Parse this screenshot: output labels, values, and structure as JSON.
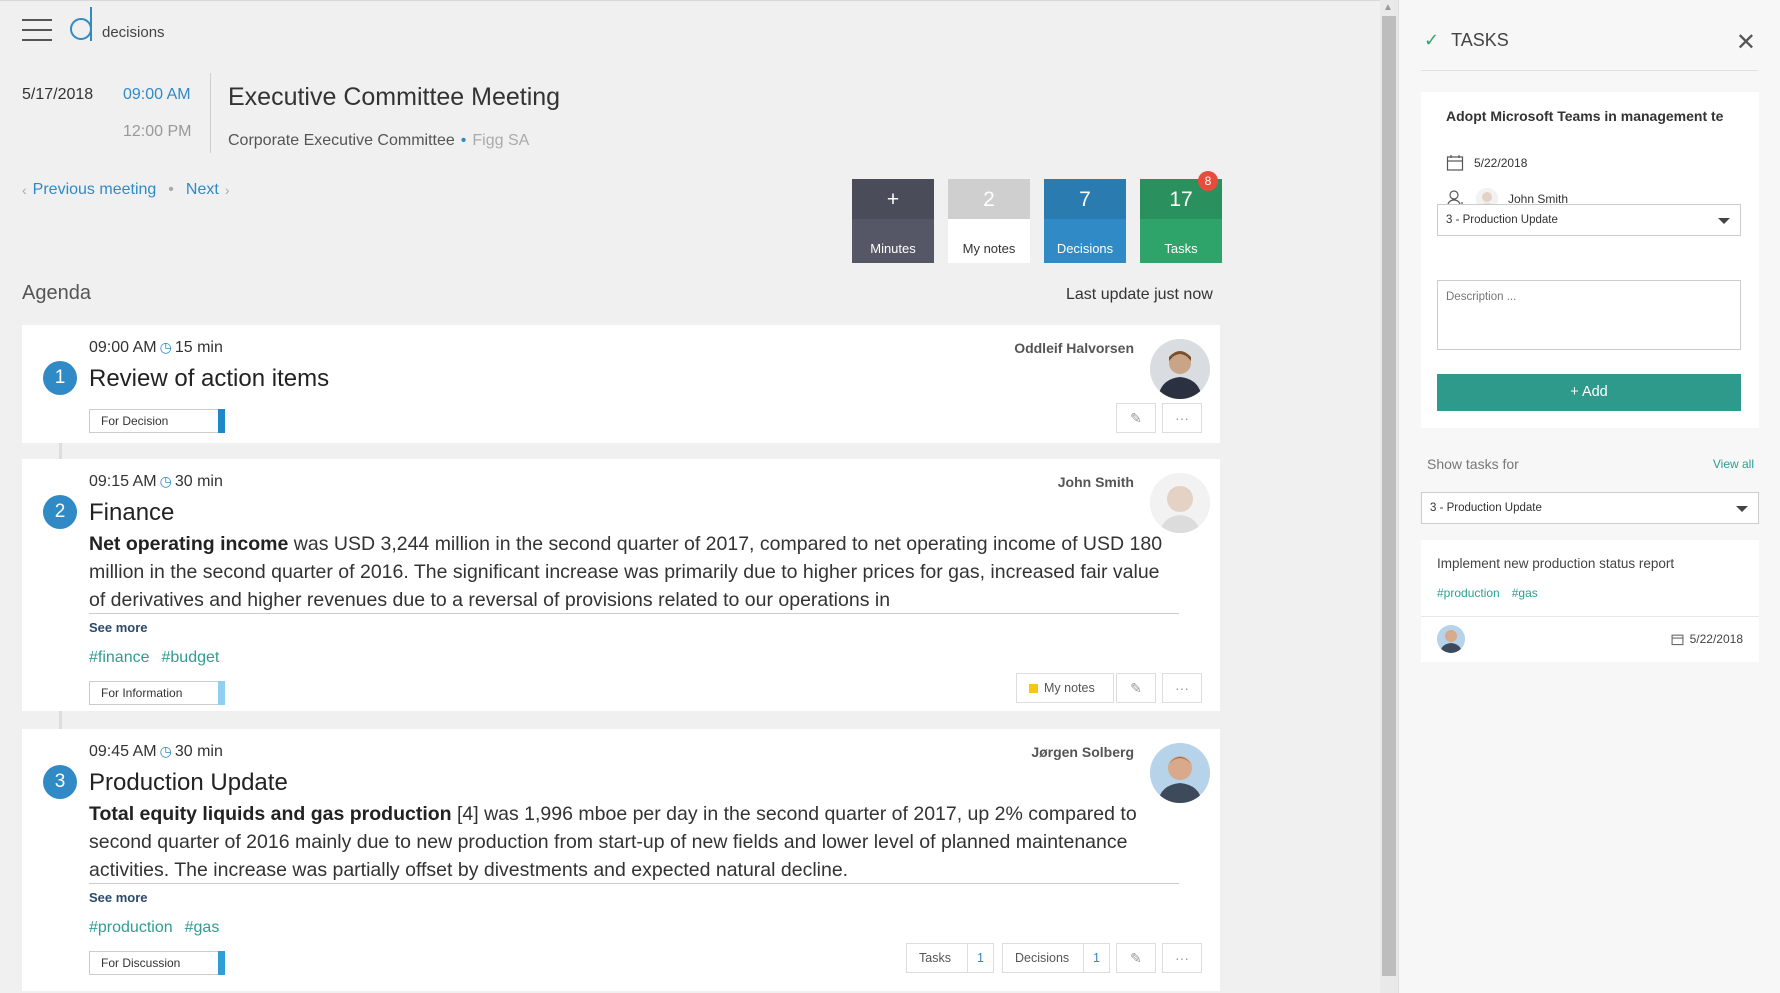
{
  "app": {
    "name": "decisions"
  },
  "meeting": {
    "date": "5/17/2018",
    "start_time": "09:00 AM",
    "end_time": "12:00 PM",
    "title": "Executive Committee Meeting",
    "committee": "Corporate Executive Committee",
    "company": "Figg SA",
    "prev_label": "Previous meeting",
    "next_label": "Next"
  },
  "tiles": {
    "minutes": {
      "value": "+",
      "label": "Minutes"
    },
    "notes": {
      "value": "2",
      "label": "My notes"
    },
    "decisions": {
      "value": "7",
      "label": "Decisions"
    },
    "tasks": {
      "value": "17",
      "label": "Tasks",
      "badge": "8"
    }
  },
  "agenda": {
    "title": "Agenda",
    "last_update": "Last update just now",
    "items": [
      {
        "number": "1",
        "time": "09:00 AM",
        "duration": "15 min",
        "title": "Review of action items",
        "presenter": "Oddleif Halvorsen",
        "status": "For Decision",
        "status_color": "#1e88c8"
      },
      {
        "number": "2",
        "time": "09:15 AM",
        "duration": "30 min",
        "title": "Finance",
        "presenter": "John Smith",
        "desc_bold": "Net operating income",
        "desc_rest": " was USD 3,244 million in the second quarter of 2017, compared to net operating income of USD 180 million in the second quarter of 2016. The significant increase was primarily due to higher prices for gas, increased fair value of derivatives and higher revenues due to a reversal of provisions related to our operations in",
        "see_more": "See more",
        "tags": [
          "#finance",
          "#budget"
        ],
        "status": "For Information",
        "status_color": "#8fd0f0",
        "notes_label": "My notes"
      },
      {
        "number": "3",
        "time": "09:45 AM",
        "duration": "30 min",
        "title": "Production Update",
        "presenter": "Jørgen Solberg",
        "desc_bold": "Total equity liquids and gas production",
        "desc_rest": " [4] was 1,996 mboe per day in the second quarter of 2017, up 2% compared to second quarter of 2016 mainly due to new production from start-up of new fields and lower level of planned maintenance activities. The increase was partially offset by divestments and expected natural decline.",
        "see_more": "See more",
        "tags": [
          "#production",
          "#gas"
        ],
        "status": "For Discussion",
        "status_color": "#2f9ed8",
        "tasks_label": "Tasks",
        "tasks_count": "1",
        "decisions_label": "Decisions",
        "decisions_count": "1"
      }
    ]
  },
  "panel": {
    "title": "TASKS",
    "new_task": {
      "title": "Adopt Microsoft Teams in management te",
      "due_date": "5/22/2018",
      "assignee": "John Smith",
      "agenda_item": "3 - Production Update",
      "description_placeholder": "Description ...",
      "add_label": "Add"
    },
    "show_tasks_for": "Show tasks for",
    "view_all": "View all",
    "filter": "3 - Production Update",
    "tasks": [
      {
        "title": "Implement new production status report",
        "tags": [
          "#production",
          "#gas"
        ],
        "due_date": "5/22/2018"
      }
    ]
  },
  "colors": {
    "accent": "#2f8ac6",
    "teal": "#2e9a8b",
    "green": "#2fa46a",
    "badge": "#e74c3c"
  },
  "icons": [
    "hamburger-icon",
    "clock-icon",
    "edit-icon",
    "more-icon",
    "note-icon",
    "check-icon",
    "close-icon",
    "calendar-icon",
    "assign-user-icon",
    "plus-icon",
    "chevron-down-icon"
  ]
}
